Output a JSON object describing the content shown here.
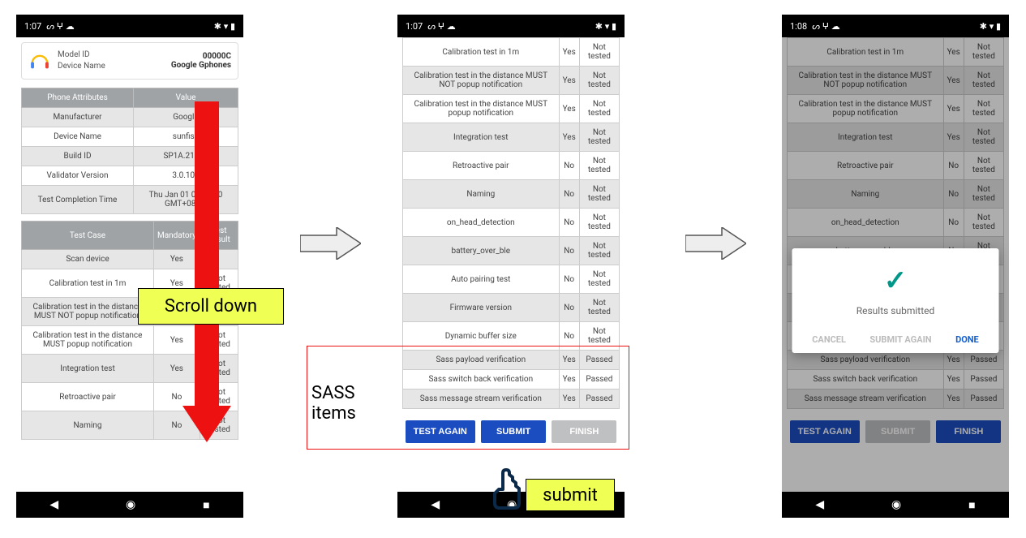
{
  "status": {
    "time_a": "1:07",
    "time_c": "1:08",
    "icons_left": "ᔕ  ⵖ  ☁",
    "icons_right": "✱ ▾ ▮"
  },
  "device": {
    "model_id_label": "Model ID",
    "model_id_value": "00000C",
    "name_label": "Device Name",
    "name_value": "Google Gphones"
  },
  "attr_headers": {
    "col1": "Phone Attributes",
    "col2": "Value"
  },
  "attrs": [
    {
      "k": "Manufacturer",
      "v": "Google"
    },
    {
      "k": "Device Name",
      "v": "sunfish"
    },
    {
      "k": "Build ID",
      "v": "SP1A.21110"
    },
    {
      "k": "Validator Version",
      "v": "3.0.101"
    },
    {
      "k": "Test Completion Time",
      "v": "Thu Jan 01 08:00:00\nGMT+08:00"
    }
  ],
  "test_headers": {
    "col1": "Test Case",
    "col2": "Mandatory",
    "col3": "Test Result"
  },
  "tests_full": [
    {
      "name": "Scan device",
      "mand": "Yes",
      "res": ""
    },
    {
      "name": "Calibration test in 1m",
      "mand": "Yes",
      "res": "Not tested"
    },
    {
      "name": "Calibration test in the distance MUST NOT popup notification",
      "mand": "Yes",
      "res": "Not tested"
    },
    {
      "name": "Calibration test in the distance MUST popup notification",
      "mand": "Yes",
      "res": "Not tested"
    },
    {
      "name": "Integration test",
      "mand": "Yes",
      "res": "Not tested"
    },
    {
      "name": "Retroactive pair",
      "mand": "No",
      "res": "Not tested"
    },
    {
      "name": "Naming",
      "mand": "No",
      "res": "Not tested"
    },
    {
      "name": "on_head_detection",
      "mand": "No",
      "res": "Not tested"
    },
    {
      "name": "battery_over_ble",
      "mand": "No",
      "res": "Not tested"
    },
    {
      "name": "Auto pairing test",
      "mand": "No",
      "res": "Not tested"
    },
    {
      "name": "Firmware version",
      "mand": "No",
      "res": "Not tested"
    },
    {
      "name": "Dynamic buffer size",
      "mand": "No",
      "res": "Not tested"
    },
    {
      "name": "Sass payload verification",
      "mand": "Yes",
      "res": "Passed"
    },
    {
      "name": "Sass switch back verification",
      "mand": "Yes",
      "res": "Passed"
    },
    {
      "name": "Sass message stream verification",
      "mand": "Yes",
      "res": "Passed"
    }
  ],
  "buttons": {
    "test_again": "TEST AGAIN",
    "submit": "SUBMIT",
    "finish": "FINISH"
  },
  "dialog": {
    "msg": "Results submitted",
    "cancel": "CANCEL",
    "submit_again": "SUBMIT AGAIN",
    "done": "DONE"
  },
  "annotations": {
    "scroll_down": "Scroll down",
    "submit": "submit",
    "sass": "SASS\nitems"
  }
}
